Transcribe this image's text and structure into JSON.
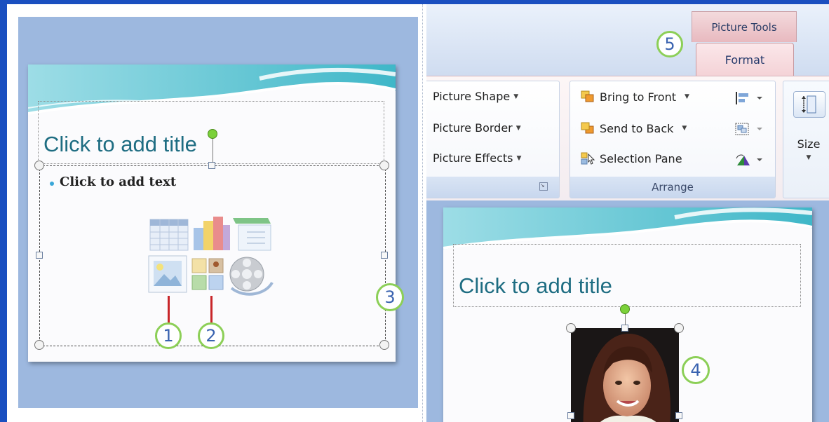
{
  "ribbon": {
    "context_tab": "Picture Tools",
    "active_tab": "Format",
    "picture_styles_group": {
      "items": [
        "Picture Shape",
        "Picture Border",
        "Picture Effects"
      ]
    },
    "arrange_group": {
      "label": "Arrange",
      "items": [
        "Bring to Front",
        "Send to Back",
        "Selection Pane"
      ]
    },
    "size_group": {
      "button_label": "Size"
    }
  },
  "left_slide": {
    "title_placeholder": "Click to add title",
    "body_placeholder": "Click to add text",
    "content_icons": [
      "insert-table-icon",
      "insert-chart-icon",
      "insert-smartart-icon",
      "insert-picture-icon",
      "insert-clip-art-icon",
      "insert-media-icon"
    ]
  },
  "right_slide": {
    "title_placeholder": "Click to add title"
  },
  "callouts": [
    "1",
    "2",
    "3",
    "4",
    "5"
  ],
  "colors": {
    "title_text": "#1e6d82",
    "callout_ring": "#8ccf57",
    "callout_number": "#3a63b0",
    "connector_red": "#c8262a",
    "panel_background": "#9db8df"
  }
}
